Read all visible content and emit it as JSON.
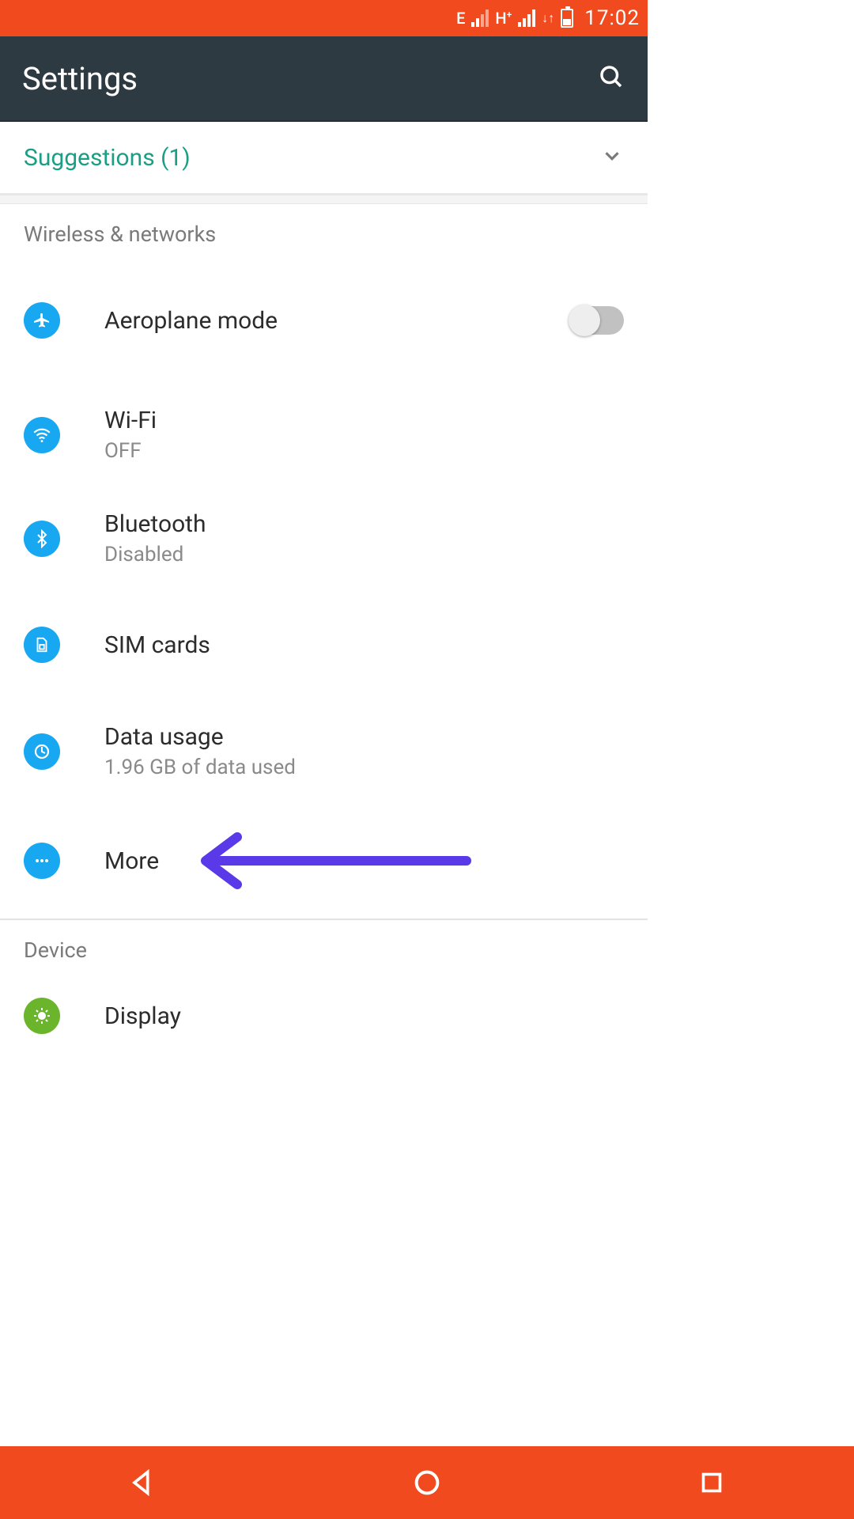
{
  "status": {
    "net1_label": "E",
    "net2_label": "H",
    "net2_suffix": "+",
    "time": "17:02"
  },
  "appbar": {
    "title": "Settings"
  },
  "suggestions": {
    "label": "Suggestions (1)"
  },
  "sections": {
    "wireless_header": "Wireless & networks",
    "device_header": "Device"
  },
  "items": {
    "aeroplane": {
      "label": "Aeroplane mode"
    },
    "wifi": {
      "label": "Wi-Fi",
      "status": "OFF"
    },
    "bluetooth": {
      "label": "Bluetooth",
      "status": "Disabled"
    },
    "sim": {
      "label": "SIM cards"
    },
    "data": {
      "label": "Data usage",
      "status": "1.96 GB of data used"
    },
    "more": {
      "label": "More"
    },
    "display": {
      "label": "Display"
    }
  },
  "colors": {
    "accent": "#f04a1e",
    "appbar": "#2e3a41",
    "teal": "#1a9e84",
    "icon_blue": "#18a8f2",
    "icon_green": "#6bb52c",
    "annotation": "#5a39e8"
  }
}
